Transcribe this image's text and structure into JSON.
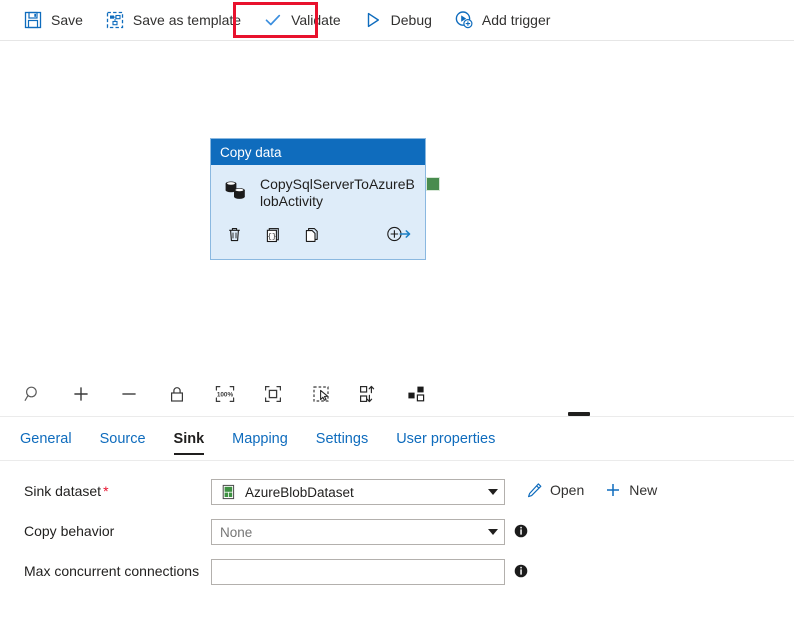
{
  "toolbar": {
    "buttons": [
      {
        "label": "Save",
        "icon": "save-icon"
      },
      {
        "label": "Save as template",
        "icon": "save-as-template-icon"
      },
      {
        "label": "Validate",
        "icon": "checkmark-icon"
      },
      {
        "label": "Debug",
        "icon": "play-triangle-icon"
      },
      {
        "label": "Add trigger",
        "icon": "add-trigger-icon"
      }
    ],
    "highlight_color": "#e8112d",
    "highlighted_button": "Validate"
  },
  "canvas": {
    "validation_indicator": {
      "name": "validation-error-circle",
      "color": "#e8112d"
    },
    "activity": {
      "type_label": "Copy data",
      "name": "CopySqlServerToAzureBlobActivity",
      "header_color": "#0f6cbd",
      "body_color": "#deecf9",
      "icon": "copy-data-database-icon",
      "actions": [
        {
          "name": "delete-activity-button",
          "icon": "trash-icon"
        },
        {
          "name": "view-code-button",
          "icon": "code-braces-icon"
        },
        {
          "name": "clone-activity-button",
          "icon": "duplicate-icon"
        },
        {
          "name": "add-output-button",
          "icon": "add-arrow-icon"
        }
      ],
      "output_connector": {
        "name": "output-connector",
        "color": "#498c4e"
      }
    }
  },
  "zoom_bar": {
    "buttons": [
      {
        "name": "search-icon",
        "title": "Search"
      },
      {
        "name": "zoom-in-icon",
        "title": "Zoom in"
      },
      {
        "name": "zoom-out-icon",
        "title": "Zoom out"
      },
      {
        "name": "lock-icon",
        "title": "Lock canvas"
      },
      {
        "name": "zoom-100-icon",
        "title": "Zoom to 100%"
      },
      {
        "name": "fit-to-screen-icon",
        "title": "Zoom to fit"
      },
      {
        "name": "select-region-icon",
        "title": "Select"
      },
      {
        "name": "auto-align-icon",
        "title": "Auto align"
      },
      {
        "name": "layout-icon",
        "title": "Layout"
      }
    ],
    "zoom_level_label": "100%"
  },
  "properties": {
    "tabs": [
      {
        "label": "General",
        "active": false
      },
      {
        "label": "Source",
        "active": false
      },
      {
        "label": "Sink",
        "active": true
      },
      {
        "label": "Mapping",
        "active": false
      },
      {
        "label": "Settings",
        "active": false
      },
      {
        "label": "User properties",
        "active": false
      }
    ],
    "fields": {
      "sink_dataset": {
        "label": "Sink dataset",
        "required_marker": "*",
        "value": "AzureBlobDataset",
        "icon": "dataset-file-icon",
        "actions": [
          {
            "label": "Open",
            "icon": "pencil-icon"
          },
          {
            "label": "New",
            "icon": "plus-icon"
          }
        ]
      },
      "copy_behavior": {
        "label": "Copy behavior",
        "placeholder": "None",
        "value": "",
        "has_info": true
      },
      "max_concurrent_connections": {
        "label": "Max concurrent connections",
        "placeholder": "",
        "value": "",
        "has_info": true
      }
    }
  }
}
